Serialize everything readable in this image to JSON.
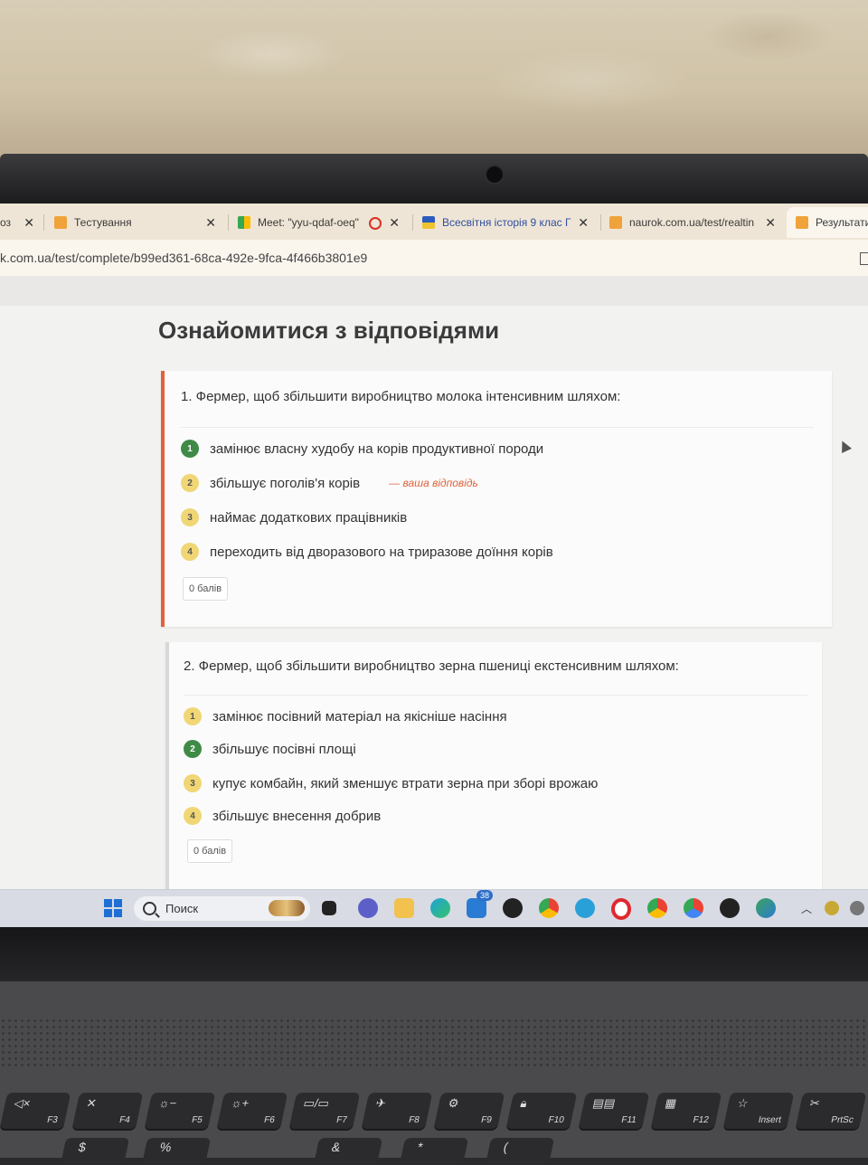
{
  "browser": {
    "tabs": [
      {
        "label": "оз",
        "active": false
      },
      {
        "label": "Тестування",
        "active": false
      },
      {
        "label": "Meet: \"yyu-qdaf-oeq\"",
        "active": false
      },
      {
        "label": "Всесвітня історія 9 клас Г",
        "active": false
      },
      {
        "label": "naurok.com.ua/test/realtin",
        "active": false
      },
      {
        "label": "Результати",
        "active": true
      }
    ],
    "url": "k.com.ua/test/complete/b99ed361-68ca-492e-9fca-4f466b3801e9"
  },
  "page": {
    "title": "Ознайомитися з відповідями",
    "questions": [
      {
        "text": "1. Фермер, щоб збільшити виробництво молока інтенсивним шляхом:",
        "answers": [
          {
            "num": "1",
            "text": "замінює власну худобу на корів продуктивної породи",
            "status": "correct"
          },
          {
            "num": "2",
            "text": "збільшує поголів'я корів",
            "status": "wrong",
            "note": "— ваша відповідь"
          },
          {
            "num": "3",
            "text": "наймає додаткових працівників",
            "status": "wrong"
          },
          {
            "num": "4",
            "text": "переходить від дворазового на триразове доїння корів",
            "status": "wrong"
          }
        ],
        "score": "0 балів"
      },
      {
        "text": "2. Фермер, щоб збільшити виробництво зерна пшениці екстенсивним шляхом:",
        "answers": [
          {
            "num": "1",
            "text": "замінює посівний матеріал на якісніше насіння",
            "status": "wrong"
          },
          {
            "num": "2",
            "text": "збільшує посівні площі",
            "status": "correct"
          },
          {
            "num": "3",
            "text": "купує комбайн, який зменшує втрати зерна при зборі врожаю",
            "status": "wrong"
          },
          {
            "num": "4",
            "text": "збільшує внесення добрив",
            "status": "wrong"
          }
        ],
        "score": "0 балів"
      }
    ]
  },
  "taskbar": {
    "search_label": "Поиск",
    "mail_badge": "38",
    "icons": [
      "windows-start-icon",
      "task-view-icon",
      "meet-icon",
      "file-explorer-icon",
      "edge-icon",
      "mail-icon",
      "app-w-icon",
      "chrome-profile-icon",
      "telegram-icon",
      "opera-icon",
      "chrome-icon",
      "chrome-red-icon",
      "app-w2-icon",
      "globe-icon"
    ]
  },
  "keyboard": {
    "fkeys": [
      "F3",
      "F4",
      "F5",
      "F6",
      "F7",
      "F8",
      "F9",
      "F10",
      "F11",
      "F12",
      "Insert",
      "PrtSc"
    ],
    "row2": [
      "$",
      "%",
      "&",
      "*",
      "("
    ]
  },
  "colors": {
    "accent_orange": "#e0623c",
    "correct_green": "#3f8a46",
    "answer_yellow": "#f0d675"
  }
}
